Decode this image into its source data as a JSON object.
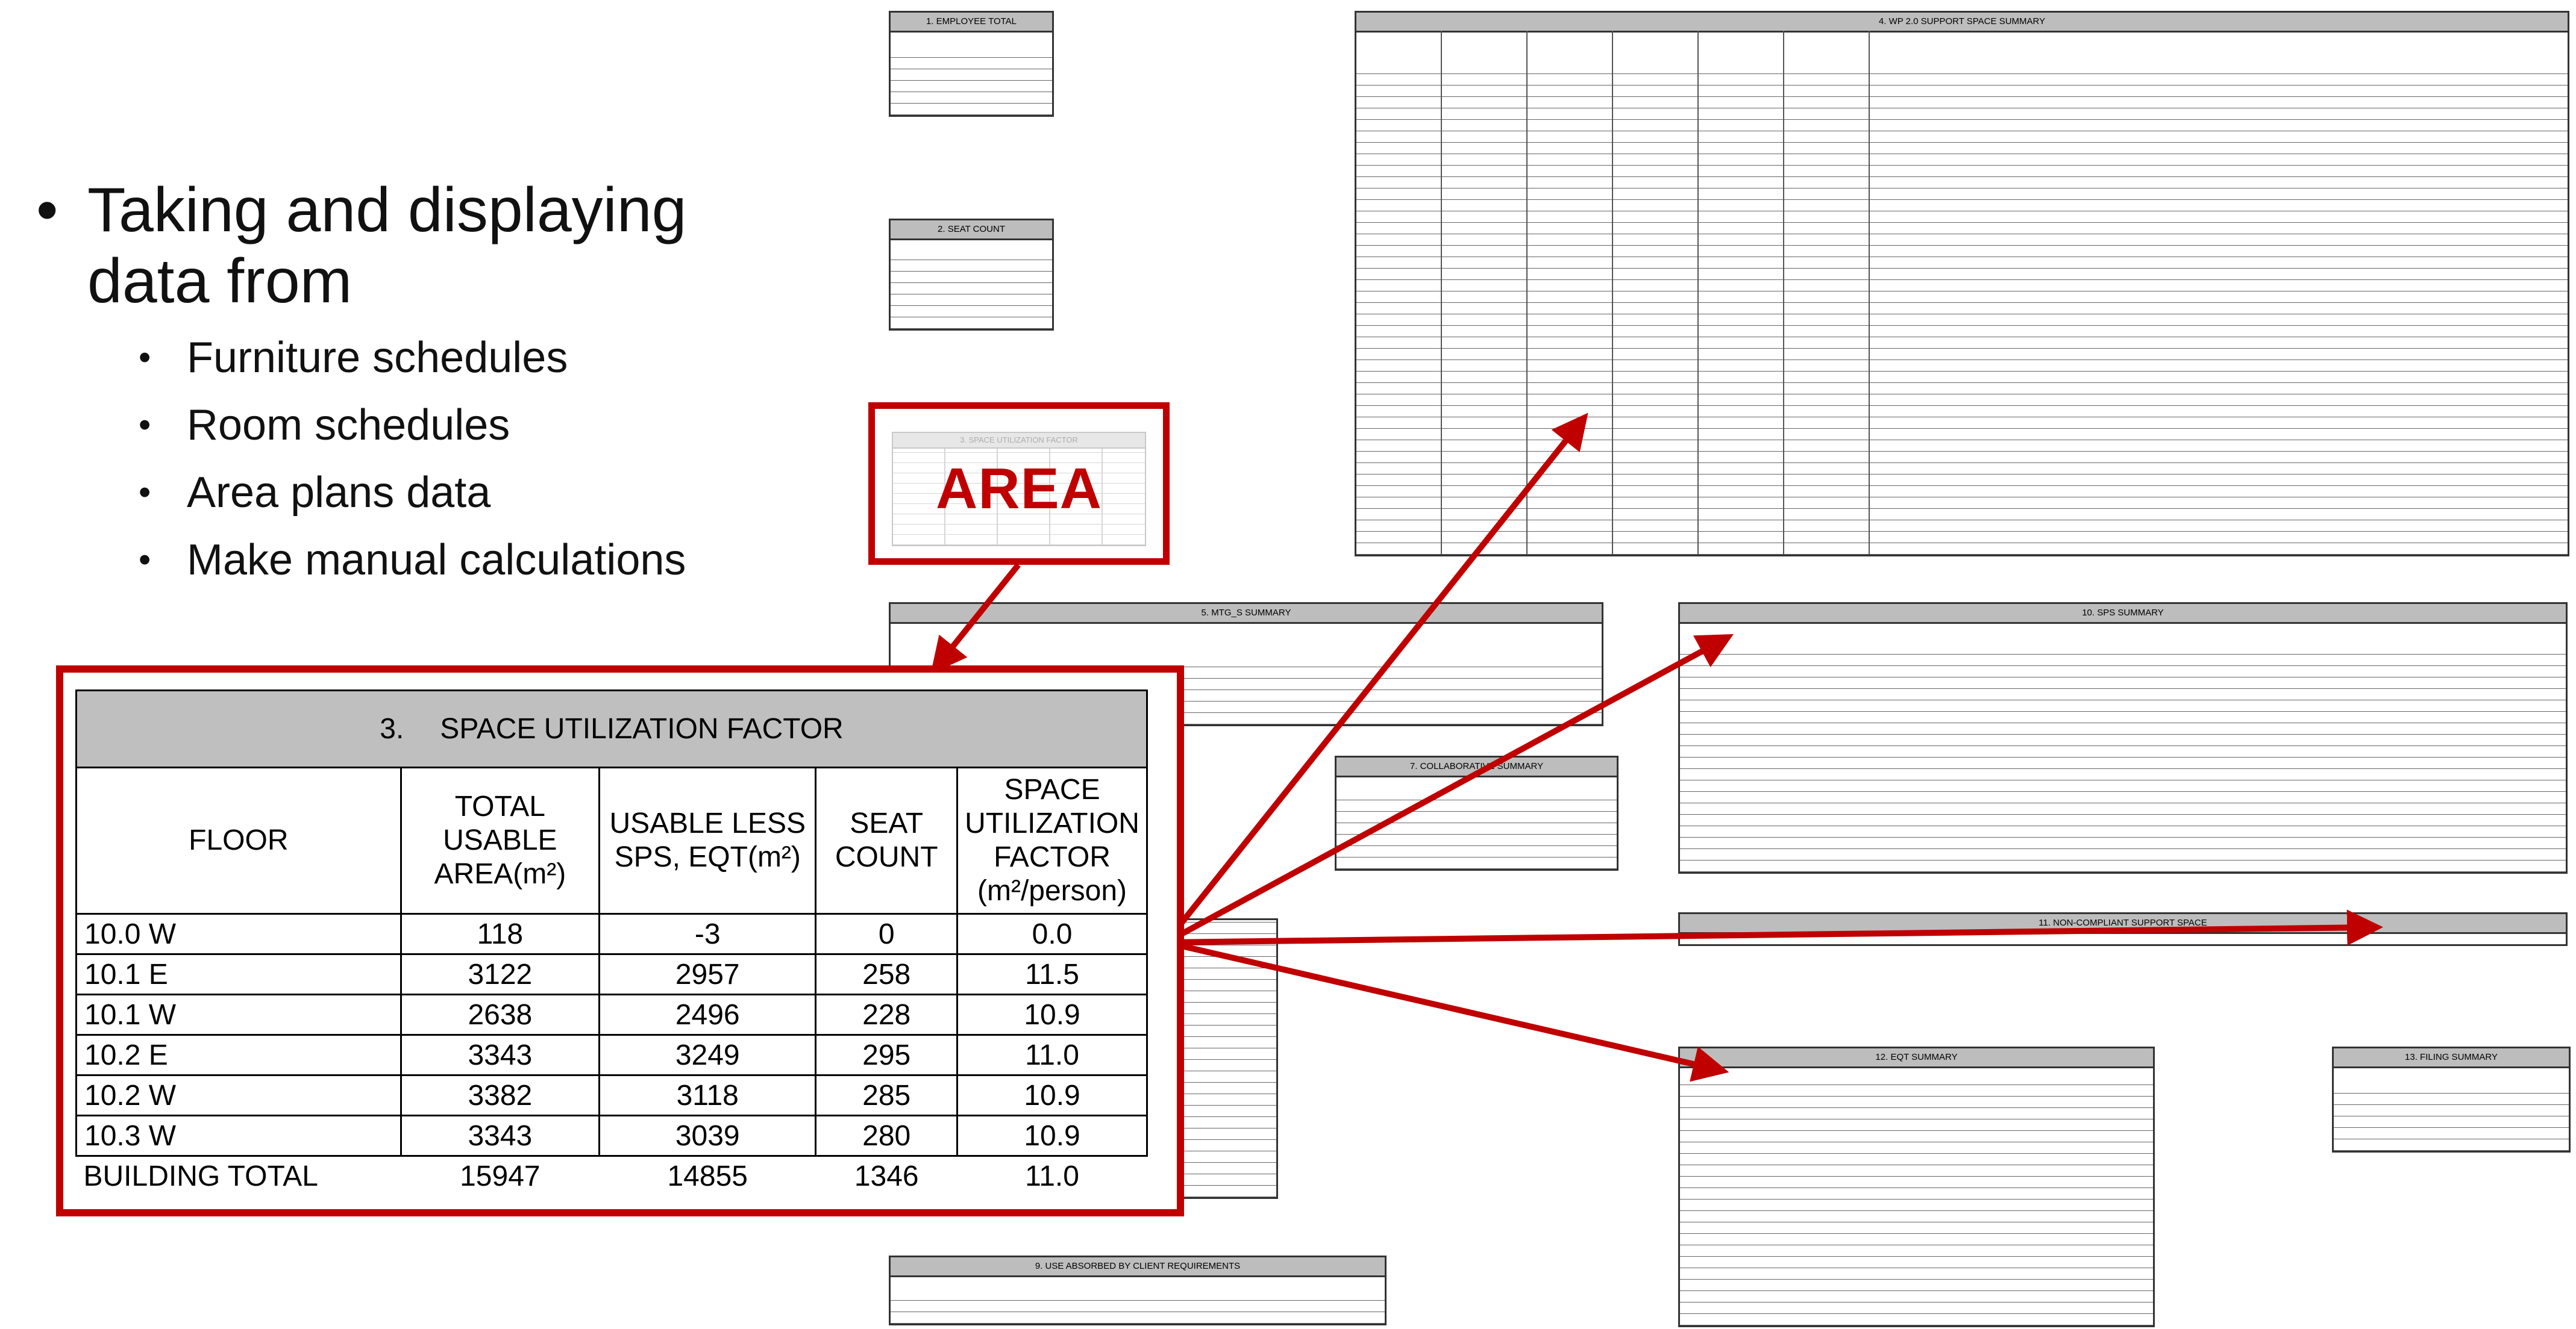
{
  "bullets": {
    "main": "Taking and displaying data from",
    "main_line1": "Taking and displaying",
    "main_line2": "data from",
    "items": [
      "Furniture schedules",
      "Room schedules",
      "Area plans data",
      "Make manual calculations"
    ]
  },
  "area_callout": {
    "label": "AREA",
    "faded_title": "3.     SPACE UTILIZATION FACTOR"
  },
  "space_utilization": {
    "section_number": "3.",
    "title": "SPACE UTILIZATION FACTOR",
    "columns": [
      "FLOOR",
      "TOTAL USABLE AREA(m²)",
      "USABLE LESS SPS, EQT(m²)",
      "SEAT COUNT",
      "SPACE UTILIZATION FACTOR (m²/person)"
    ],
    "rows": [
      {
        "floor": "10.0 W",
        "total_usable": "118",
        "usable_less": "-3",
        "seat_count": "0",
        "factor": "0.0"
      },
      {
        "floor": "10.1 E",
        "total_usable": "3122",
        "usable_less": "2957",
        "seat_count": "258",
        "factor": "11.5"
      },
      {
        "floor": "10.1 W",
        "total_usable": "2638",
        "usable_less": "2496",
        "seat_count": "228",
        "factor": "10.9"
      },
      {
        "floor": "10.2 E",
        "total_usable": "3343",
        "usable_less": "3249",
        "seat_count": "295",
        "factor": "11.0"
      },
      {
        "floor": "10.2 W",
        "total_usable": "3382",
        "usable_less": "3118",
        "seat_count": "285",
        "factor": "10.9"
      },
      {
        "floor": "10.3 W",
        "total_usable": "3343",
        "usable_less": "3039",
        "seat_count": "280",
        "factor": "10.9"
      }
    ],
    "total": {
      "floor": "BUILDING TOTAL",
      "total_usable": "15947",
      "usable_less": "14855",
      "seat_count": "1346",
      "factor": "11.0"
    }
  },
  "background_tables": {
    "employee_total": "1.     EMPLOYEE TOTAL",
    "seat_count": "2.     SEAT COUNT",
    "wp_support": "4.     WP 2.0 SUPPORT SPACE SUMMARY",
    "mtg_summary": "5.     MTG_S SUMMARY",
    "collab": "7.     COLLABORATIVE SUMMARY",
    "sps_summary": "10.     SPS SUMMARY",
    "noncompliant": "11.     NON-COMPLIANT SUPPORT SPACE",
    "eqt_summary": "12.     EQT SUMMARY",
    "filing_summary": "13.     FILING SUMMARY",
    "use_absorbed": "9.     USE ABSORBED BY CLIENT REQUIREMENTS",
    "building_total": "BUILDING TOTAL"
  },
  "colors": {
    "accent_red": "#c00000",
    "header_gray": "#bfbfbf"
  }
}
